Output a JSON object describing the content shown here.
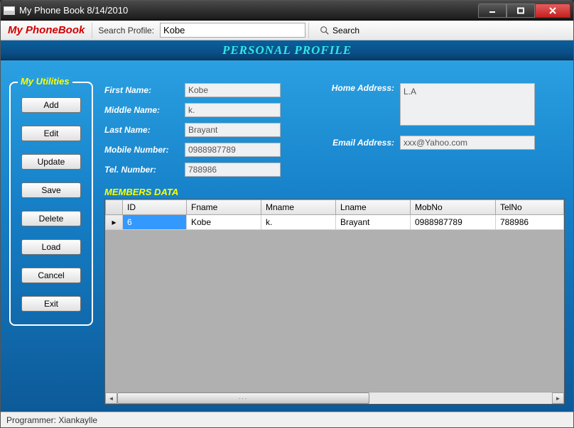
{
  "window": {
    "title": "My Phone Book 8/14/2010"
  },
  "toolbar": {
    "brand": "My PhoneBook",
    "search_label": "Search Profile:",
    "search_value": "Kobe",
    "search_button": "Search"
  },
  "banner": "PERSONAL PROFILE",
  "utilities": {
    "legend": "My Utilities",
    "buttons": [
      "Add",
      "Edit",
      "Update",
      "Save",
      "Delete",
      "Load",
      "Cancel",
      "Exit"
    ]
  },
  "form": {
    "first_name_label": "First Name:",
    "first_name": "Kobe",
    "middle_name_label": "Middle Name:",
    "middle_name": "k.",
    "last_name_label": "Last Name:",
    "last_name": "Brayant",
    "mobile_label": "Mobile Number:",
    "mobile": "0988987789",
    "tel_label": "Tel. Number:",
    "tel": "788986",
    "home_label": "Home Address:",
    "home": "L.A",
    "email_label": "Email Address:",
    "email": "xxx@Yahoo.com"
  },
  "data_heading": "MEMBERS DATA",
  "grid": {
    "columns": [
      "ID",
      "Fname",
      "Mname",
      "Lname",
      "MobNo",
      "TelNo"
    ],
    "rows": [
      [
        "6",
        "Kobe",
        "k.",
        "Brayant",
        "0988987789",
        "788986"
      ]
    ]
  },
  "status": "Programmer: Xiankaylle"
}
